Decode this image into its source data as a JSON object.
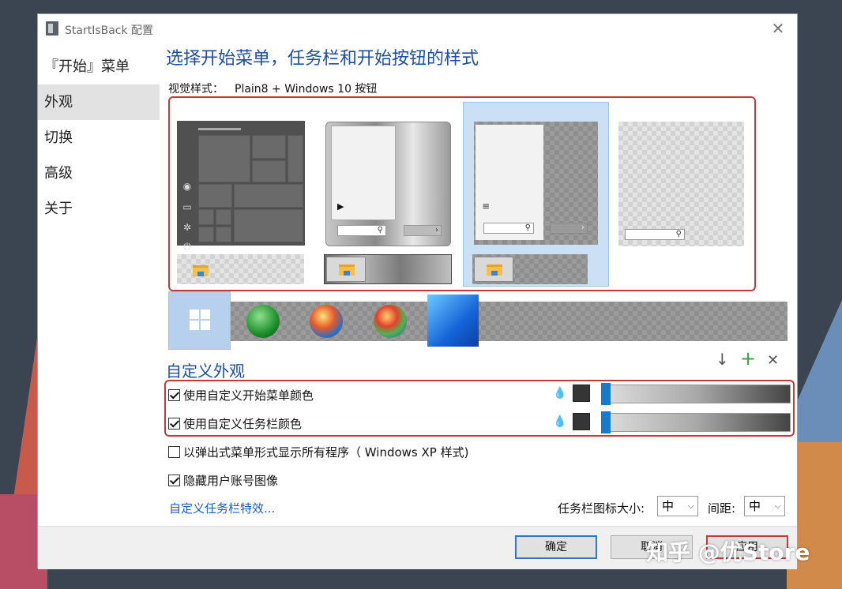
{
  "window": {
    "title": "StartIsBack 配置",
    "close_glyph": "✕"
  },
  "sidebar": {
    "items": [
      {
        "label": "『开始』菜单"
      },
      {
        "label": "外观"
      },
      {
        "label": "切换"
      },
      {
        "label": "高级"
      },
      {
        "label": "关于"
      }
    ]
  },
  "main": {
    "heading": "选择开始菜单，任务栏和开始按钮的样式",
    "visual_style_label": "视觉样式：",
    "visual_style_value": "Plain8 + Windows 10 按钮"
  },
  "custom": {
    "heading": "自定义外观",
    "tools": {
      "download": "↓",
      "add": "+",
      "remove": "✕"
    },
    "options": [
      {
        "label": "使用自定义开始菜单颜色",
        "checked": true
      },
      {
        "label": "使用自定义任务栏颜色",
        "checked": true
      },
      {
        "label": "以弹出式菜单形式显示所有程序（ Windows XP 样式)",
        "checked": false
      },
      {
        "label": "隐藏用户账号图像",
        "checked": true
      }
    ],
    "link": "自定义任务栏特效...",
    "icon_size_label": "任务栏图标大小:",
    "icon_size_value": "中",
    "spacing_label": "间距:",
    "spacing_value": "中",
    "colors": {
      "start_menu_swatch": "#353535",
      "taskbar_swatch": "#353535",
      "accent": "#1979ca"
    },
    "slider_levels": {
      "start_menu": 0.0,
      "taskbar": 0.0
    }
  },
  "footer": {
    "ok_label": "确定",
    "cancel_label": "取消",
    "apply_label": "应用"
  },
  "watermark": "知乎 @优Store"
}
